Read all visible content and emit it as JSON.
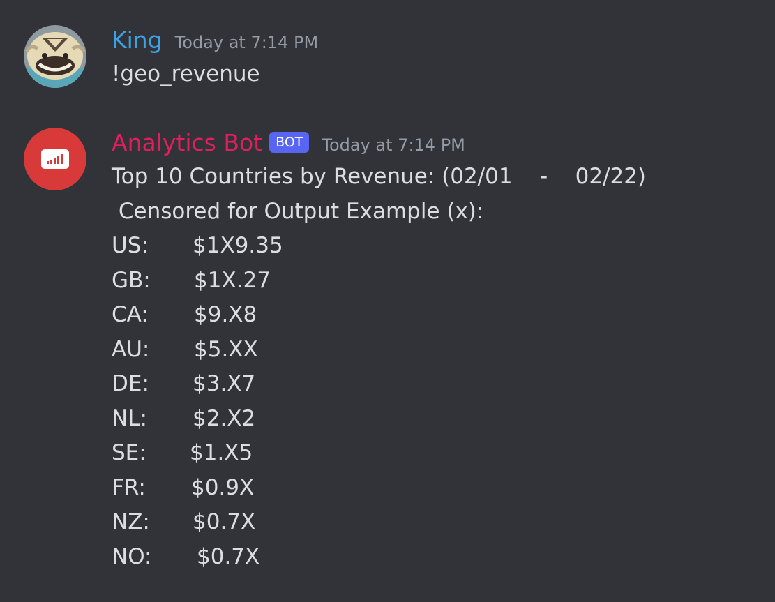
{
  "messages": [
    {
      "username": "King",
      "timestamp": "Today at 7:14 PM",
      "avatar_icon": "bison-avatar-icon",
      "lines": [
        "!geo_revenue"
      ]
    },
    {
      "username": "Analytics Bot",
      "badge": "BOT",
      "timestamp": "Today at 7:14 PM",
      "avatar_icon": "chart-bars-icon",
      "title": "Top 10 Countries by Revenue: (02/01    -    02/22)",
      "subtitle": " Censored for Output Example (x):",
      "rows": [
        {
          "code": "US:",
          "value": "$1X9.35"
        },
        {
          "code": "GB:",
          "value": "$1X.27"
        },
        {
          "code": "CA:",
          "value": "$9.X8"
        },
        {
          "code": "AU:",
          "value": "$5.XX"
        },
        {
          "code": "DE:",
          "value": "$3.X7"
        },
        {
          "code": "NL:",
          "value": "$2.X2"
        },
        {
          "code": "SE:",
          "value": "$1.X5"
        },
        {
          "code": "FR:",
          "value": "$0.9X"
        },
        {
          "code": "NZ:",
          "value": "$0.7X"
        },
        {
          "code": "NO:",
          "value": "$0.7X"
        }
      ]
    }
  ],
  "colors": {
    "background": "#313338",
    "user_name": "#3ba3e4",
    "bot_name": "#e01f5c",
    "bot_badge": "#5865f2",
    "timestamp": "#949ba4",
    "text": "#dbdee1",
    "bot_avatar": "#d83a3a"
  }
}
